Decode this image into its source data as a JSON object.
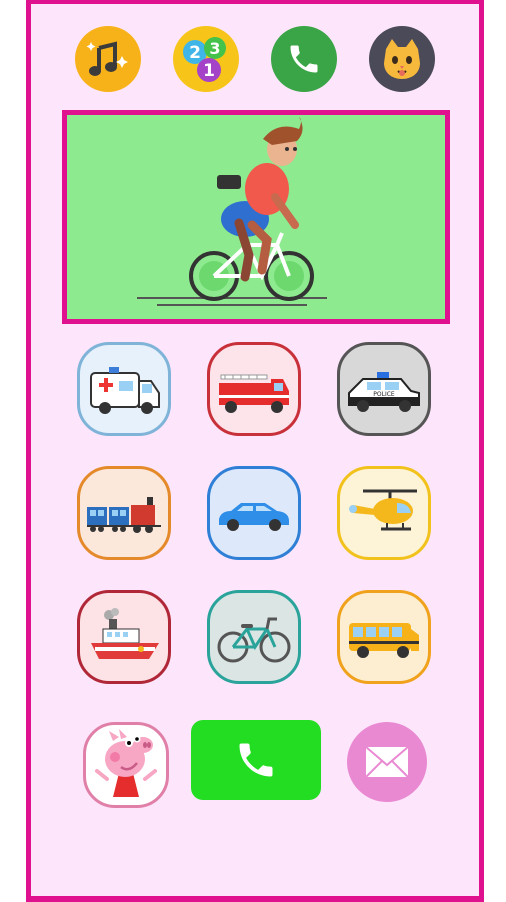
{
  "top_bar": [
    {
      "name": "music",
      "icon": "music-notes-icon",
      "color": "#f7b21a"
    },
    {
      "name": "numbers",
      "icon": "numbers-123-icon",
      "color": "#f7c51a"
    },
    {
      "name": "call",
      "icon": "phone-icon",
      "color": "#3aa546"
    },
    {
      "name": "cat",
      "icon": "cat-face-icon",
      "color": "#4a4a58"
    }
  ],
  "video": {
    "scene": "boy-riding-bicycle",
    "background": "#8eea8f"
  },
  "vehicles": [
    {
      "name": "ambulance",
      "icon": "ambulance-icon",
      "border": "#7fb3d8",
      "bg": "#e6f1fb"
    },
    {
      "name": "fire-truck",
      "icon": "fire-truck-icon",
      "border": "#c8303a",
      "bg": "#fde3ea"
    },
    {
      "name": "police-car",
      "icon": "police-car-icon",
      "border": "#555555",
      "bg": "#d8d8d8",
      "label": "POLICE"
    },
    {
      "name": "train",
      "icon": "train-icon",
      "border": "#e58a2a",
      "bg": "#fce7db"
    },
    {
      "name": "car",
      "icon": "car-icon",
      "border": "#2f7fd6",
      "bg": "#dde9fb"
    },
    {
      "name": "helicopter",
      "icon": "helicopter-icon",
      "border": "#f2c21c",
      "bg": "#fdf3d6"
    },
    {
      "name": "ship",
      "icon": "ship-icon",
      "border": "#b02838",
      "bg": "#fde2e6"
    },
    {
      "name": "bicycle",
      "icon": "bicycle-icon",
      "border": "#2aa39b",
      "bg": "#dbe6e4"
    },
    {
      "name": "school-bus",
      "icon": "school-bus-icon",
      "border": "#f0a21c",
      "bg": "#fdeed1"
    }
  ],
  "bottom_bar": [
    {
      "name": "peppa",
      "icon": "peppa-pig-icon",
      "border": "#e080a8"
    },
    {
      "name": "call",
      "icon": "phone-icon",
      "color": "#22dd22"
    },
    {
      "name": "mail",
      "icon": "envelope-icon",
      "color": "#e989d2"
    }
  ]
}
